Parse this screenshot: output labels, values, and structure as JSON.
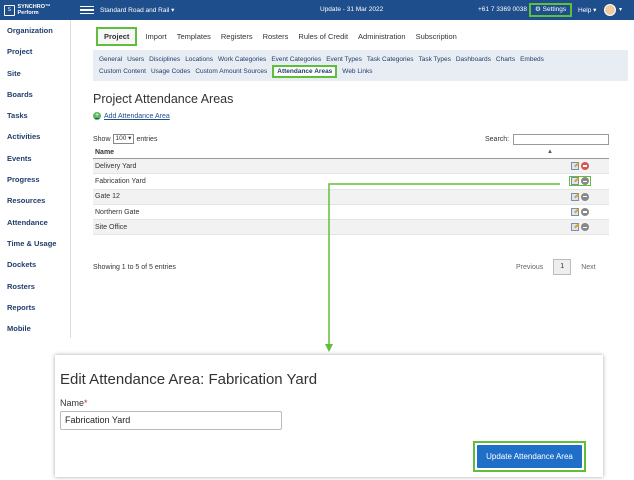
{
  "topbar": {
    "logo_text": "SYNCHRO™ Perform",
    "project": "Standard Road and Rail ▾",
    "update": "Update - 31 Mar 2022",
    "phone": "+61 7 3369 0038",
    "settings": "⚙ Settings",
    "help": "Help ▾",
    "avatar_caret": "▾"
  },
  "sidebar": {
    "items": [
      "Organization",
      "Project",
      "Site",
      "Boards",
      "Tasks",
      "Activities",
      "Events",
      "Progress",
      "Resources",
      "Attendance",
      "Time & Usage",
      "Dockets",
      "Rosters",
      "Reports",
      "Mobile"
    ]
  },
  "tabs": [
    "Project",
    "Import",
    "Templates",
    "Registers",
    "Rosters",
    "Rules of Credit",
    "Administration",
    "Subscription"
  ],
  "subnav": {
    "row1": [
      "General",
      "Users",
      "Disciplines",
      "Locations",
      "Work Categories",
      "Event Categories",
      "Event Types",
      "Task Categories",
      "Task Types",
      "Dashboards",
      "Charts",
      "Embeds"
    ],
    "row2": [
      "Custom Content",
      "Usage Codes",
      "Custom Amount Sources",
      "Attendance Areas",
      "Web Links"
    ]
  },
  "page": {
    "title": "Project Attendance Areas",
    "add_link": "Add Attendance Area",
    "show_label": "Show",
    "show_value": "100 ▾",
    "entries_label": "entries",
    "search_label": "Search:"
  },
  "table": {
    "header": "Name",
    "rows": [
      "Delivery Yard",
      "Fabrication Yard",
      "Gate 12",
      "Northern Gate",
      "Site Office"
    ]
  },
  "footer": {
    "info": "Showing 1 to 5 of 5 entries",
    "prev": "Previous",
    "page": "1",
    "next": "Next"
  },
  "edit_panel": {
    "title": "Edit Attendance Area: Fabrication Yard",
    "name_label": "Name",
    "required_mark": "*",
    "name_value": "Fabrication Yard",
    "button": "Update Attendance Area"
  },
  "colors": {
    "topbar": "#1f4e8c",
    "highlight": "#5fbf3a",
    "button": "#1f6fc8"
  }
}
